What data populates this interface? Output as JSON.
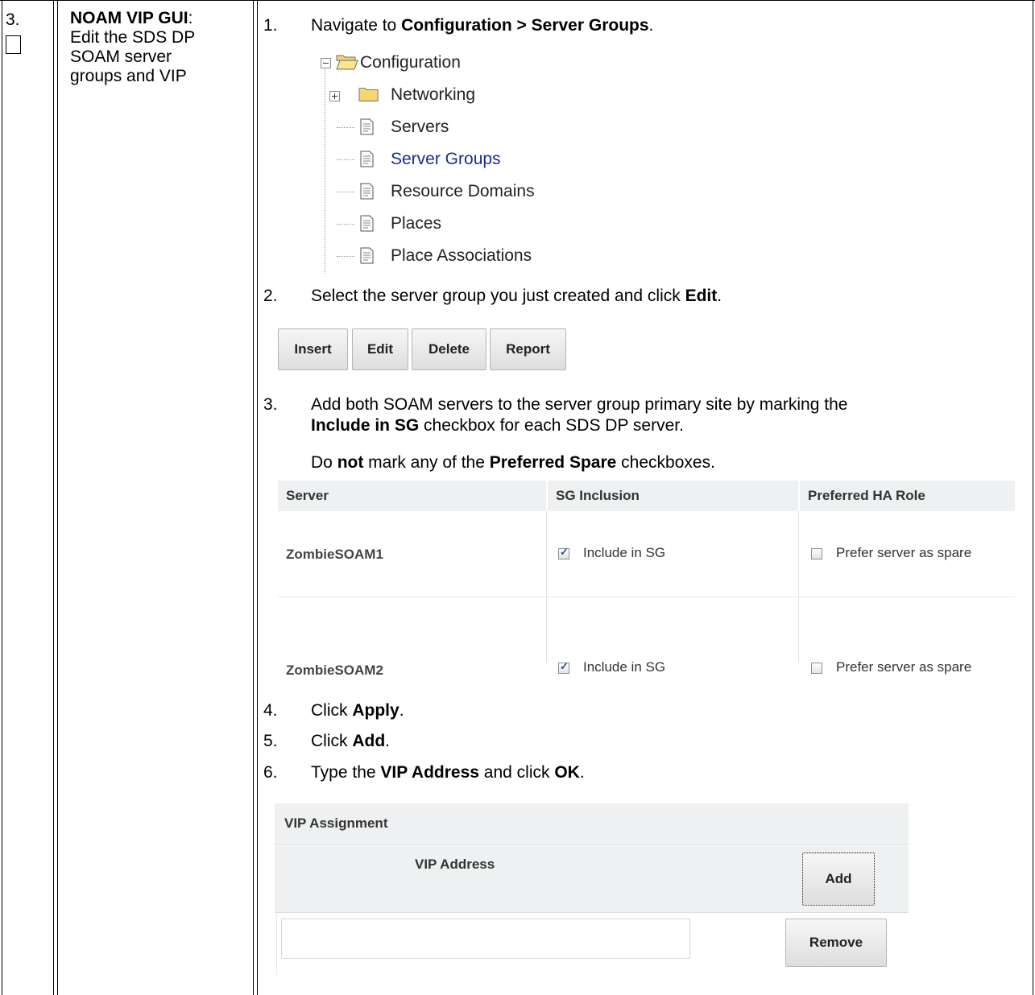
{
  "step": {
    "number": "3.",
    "title_bold": "NOAM VIP GUI",
    "title_colon": ":",
    "description": [
      "Edit the SDS DP",
      "SOAM server",
      "groups and VIP"
    ]
  },
  "instructions": {
    "s1": {
      "num": "1.",
      "pre": "Navigate to ",
      "bold": "Configuration > Server Groups",
      "post": "."
    },
    "s2": {
      "num": "2.",
      "pre": "Select the server group you just created and click ",
      "bold": "Edit",
      "post": "."
    },
    "s3": {
      "num": "3.",
      "line1": "Add both SOAM servers to the server group primary site by marking the",
      "bold": "Include in SG",
      "line2_post": " checkbox for each SDS DP server."
    },
    "s3_note": {
      "pre": "Do ",
      "bold1": "not",
      "mid": " mark any of the ",
      "bold2": "Preferred Spare",
      "post": " checkboxes."
    },
    "s4": {
      "num": "4.",
      "pre": "Click ",
      "bold": "Apply",
      "post": "."
    },
    "s5": {
      "num": "5.",
      "pre": "Click ",
      "bold": "Add",
      "post": "."
    },
    "s6": {
      "num": "6.",
      "pre": "Type the ",
      "bold1": "VIP Address",
      "mid": " and click ",
      "bold2": "OK",
      "post": "."
    }
  },
  "tree": {
    "root": "Configuration",
    "items": [
      "Networking",
      "Servers",
      "Server Groups",
      "Resource Domains",
      "Places",
      "Place Associations"
    ],
    "selected": "Server Groups"
  },
  "buttons": [
    "Insert",
    "Edit",
    "Delete",
    "Report"
  ],
  "server_table": {
    "headers": [
      "Server",
      "SG Inclusion",
      "Preferred HA Role"
    ],
    "rows": [
      {
        "server": "ZombieSOAM1",
        "inclusion": "Include in SG",
        "inclusion_checked": true,
        "role": "Prefer server as spare",
        "role_checked": false
      },
      {
        "server": "ZombieSOAM2",
        "inclusion": "Include in SG",
        "inclusion_checked": true,
        "role": "Prefer server as spare",
        "role_checked": false
      }
    ]
  },
  "vip_panel": {
    "title": "VIP Assignment",
    "column": "VIP Address",
    "add_label": "Add",
    "remove_label": "Remove",
    "input_value": ""
  },
  "colors": {
    "selected_tree_text": "#1a2e88",
    "table_header_bg": "#eef0f1",
    "checkmark": "#2d4fa8"
  }
}
